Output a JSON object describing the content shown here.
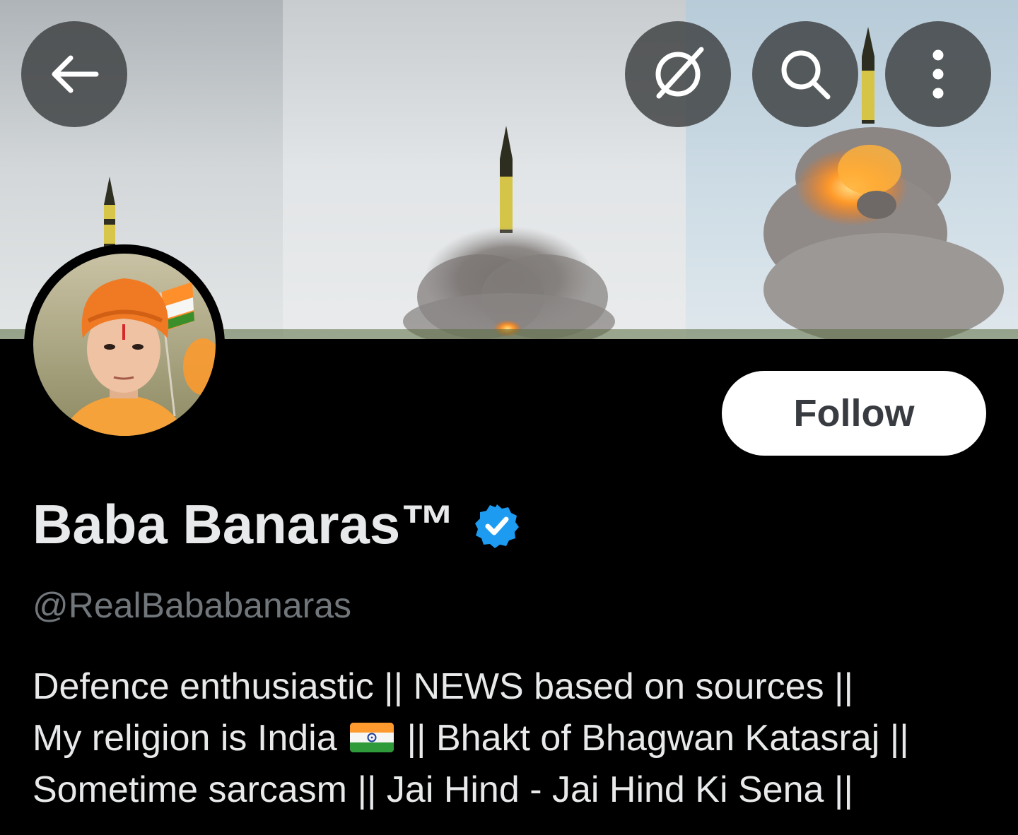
{
  "header": {
    "back_icon": "arrow-left-icon",
    "grok_icon": "grok-icon",
    "search_icon": "search-icon",
    "more_icon": "more-vertical-icon"
  },
  "banner": {
    "image": "missile-launch-banner"
  },
  "avatar": {
    "image": "profile-avatar"
  },
  "profile": {
    "display_name": "Baba Banaras™",
    "verified": true,
    "handle": "@RealBababanaras",
    "follow_label": "Follow",
    "bio": {
      "line1": "Defence enthusiastic || NEWS based on sources ||",
      "line2_before_flag": "My religion is India ",
      "line2_after_flag": " || Bhakt of Bhagwan Katasraj ||",
      "line3": "Sometime sarcasm || Jai Hind - Jai Hind Ki Sena ||"
    }
  },
  "colors": {
    "background": "#000000",
    "text_primary": "#e7e9ea",
    "text_secondary": "#71767b",
    "verified_blue": "#1d9bf0",
    "follow_bg": "#ffffff",
    "follow_text": "#383c41"
  }
}
